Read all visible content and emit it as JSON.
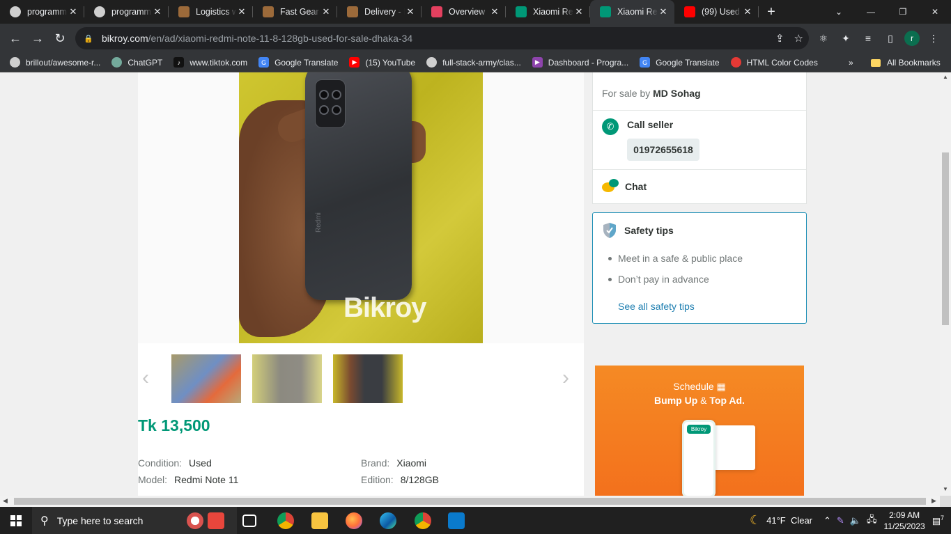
{
  "browser": {
    "tabs": [
      {
        "label": "programming",
        "icon": "github-icon",
        "color": "#cfcfcf",
        "active": false
      },
      {
        "label": "programming",
        "icon": "github-icon",
        "color": "#cfcfcf",
        "active": false
      },
      {
        "label": "Logistics website",
        "icon": "bookmark-brown-icon",
        "color": "#9c6a3a",
        "active": false
      },
      {
        "label": "Fast Gear",
        "icon": "bookmark-brown-icon",
        "color": "#9c6a3a",
        "active": false
      },
      {
        "label": "Delivery - Fast Gear",
        "icon": "bookmark-brown-icon",
        "color": "#9c6a3a",
        "active": false
      },
      {
        "label": "Overview",
        "icon": "t-logo-icon",
        "color": "#e4405f",
        "active": false
      },
      {
        "label": "Xiaomi Redmi",
        "icon": "bikroy-icon",
        "color": "#009877",
        "active": false
      },
      {
        "label": "Xiaomi Redmi",
        "icon": "bikroy-icon",
        "color": "#009877",
        "active": true
      },
      {
        "label": "(99) Used",
        "icon": "youtube-icon",
        "color": "#ff0000",
        "active": false
      }
    ],
    "tab_close": "✕",
    "new_tab": "+",
    "url_host": "bikroy.com",
    "url_path": "/en/ad/xiaomi-redmi-note-11-8-128gb-used-for-sale-dhaka-34",
    "avatar_letter": "r",
    "bookmarks": [
      {
        "label": "brillout/awesome-r...",
        "icon": "github-icon",
        "color": "#cfcfcf"
      },
      {
        "label": "ChatGPT",
        "icon": "chatgpt-icon",
        "color": "#74aa9c"
      },
      {
        "label": "www.tiktok.com",
        "icon": "tiktok-icon",
        "color": "#111111"
      },
      {
        "label": "Google Translate",
        "icon": "google-translate-icon",
        "color": "#4285f4"
      },
      {
        "label": "(15) YouTube",
        "icon": "youtube-icon",
        "color": "#ff0000"
      },
      {
        "label": "full-stack-army/clas...",
        "icon": "github-icon",
        "color": "#cfcfcf"
      },
      {
        "label": "Dashboard - Progra...",
        "icon": "play-purple-icon",
        "color": "#8e44ad"
      },
      {
        "label": "Google Translate",
        "icon": "google-translate-icon",
        "color": "#4285f4"
      },
      {
        "label": "HTML Color Codes",
        "icon": "color-codes-icon",
        "color": "#e53935"
      }
    ],
    "bookmarks_more": "»",
    "all_bookmarks": "All Bookmarks"
  },
  "listing": {
    "watermark": "Bikroy",
    "phone_brand": "Redmi",
    "price": "Tk 13,500",
    "specs": {
      "condition_label": "Condition:",
      "condition_value": "Used",
      "brand_label": "Brand:",
      "brand_value": "Xiaomi",
      "model_label": "Model:",
      "model_value": "Redmi Note 11",
      "edition_label": "Edition:",
      "edition_value": "8/128GB"
    }
  },
  "seller": {
    "for_sale_by": "For sale by",
    "name": "MD Sohag",
    "call_title": "Call seller",
    "phone": "01972655618",
    "chat_title": "Chat"
  },
  "safety": {
    "title": "Safety tips",
    "tips": [
      "Meet in a safe & public place",
      "Don’t pay in advance"
    ],
    "link": "See all safety tips"
  },
  "ad_banner": {
    "line1": "Schedule",
    "line2_a": "Bump Up",
    "line2_b": "&",
    "line2_c": "Top Ad.",
    "badge": "Bikroy"
  },
  "taskbar": {
    "search_placeholder": "Type here to search",
    "weather": "41°F  Clear",
    "time": "2:09 AM",
    "date": "11/25/2023",
    "notifications": "7"
  }
}
